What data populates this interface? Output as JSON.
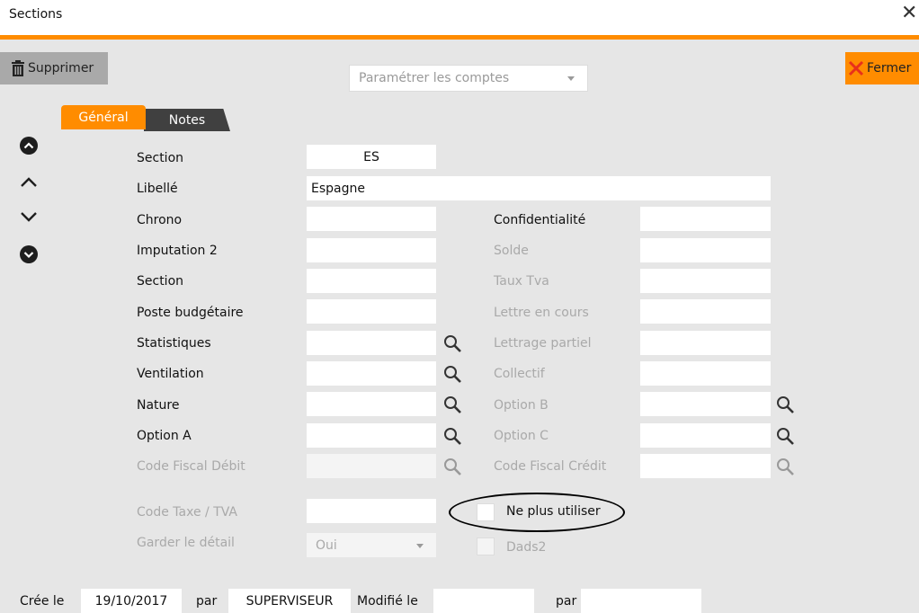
{
  "window": {
    "title": "Sections",
    "close_icon": "close-icon"
  },
  "toolbar": {
    "delete_label": "Supprimer",
    "close_label": "Fermer",
    "accounts_dropdown": "Paramétrer les comptes"
  },
  "tabs": [
    {
      "label": "Général",
      "active": true
    },
    {
      "label": "Notes",
      "active": false
    }
  ],
  "nav_icons": [
    "first-record-icon",
    "previous-record-icon",
    "next-record-icon",
    "last-record-icon"
  ],
  "form": {
    "left": [
      {
        "label": "Section",
        "value": "ES"
      },
      {
        "label": "Libellé",
        "value": "Espagne"
      },
      {
        "label": "Chrono",
        "value": ""
      },
      {
        "label": "Imputation 2",
        "value": ""
      },
      {
        "label": "Section",
        "value": ""
      },
      {
        "label": "Poste budgétaire",
        "value": ""
      },
      {
        "label": "Statistiques",
        "value": ""
      },
      {
        "label": "Ventilation",
        "value": ""
      },
      {
        "label": "Nature",
        "value": ""
      },
      {
        "label": "Option A",
        "value": ""
      },
      {
        "label": "Code Fiscal Débit",
        "value": ""
      },
      {
        "label": "Code Taxe / TVA",
        "value": ""
      },
      {
        "label": "Garder le détail",
        "value": "Oui"
      }
    ],
    "right": [
      {
        "label": "Confidentialité",
        "value": ""
      },
      {
        "label": "Solde",
        "value": ""
      },
      {
        "label": "Taux Tva",
        "value": ""
      },
      {
        "label": "Lettre en cours",
        "value": ""
      },
      {
        "label": "Lettrage partiel",
        "value": ""
      },
      {
        "label": "Collectif",
        "value": ""
      },
      {
        "label": "Option B",
        "value": ""
      },
      {
        "label": "Option C",
        "value": ""
      },
      {
        "label": "Code Fiscal Crédit",
        "value": ""
      }
    ],
    "checkboxes": [
      {
        "label": "Ne plus utiliser",
        "checked": false
      },
      {
        "label": "Dads2",
        "checked": false
      }
    ]
  },
  "footer": {
    "created_label": "Crée le",
    "created_date": "19/10/2017",
    "by_label": "par",
    "created_by": "SUPERVISEUR",
    "modified_label": "Modifié le",
    "modified_date": "",
    "by_label_2": "par",
    "modified_by": ""
  },
  "colors": {
    "accent": "#ff8c00",
    "tab_inactive": "#404040",
    "background": "#e6e6e6",
    "disabled_text": "#a9a9a9"
  }
}
